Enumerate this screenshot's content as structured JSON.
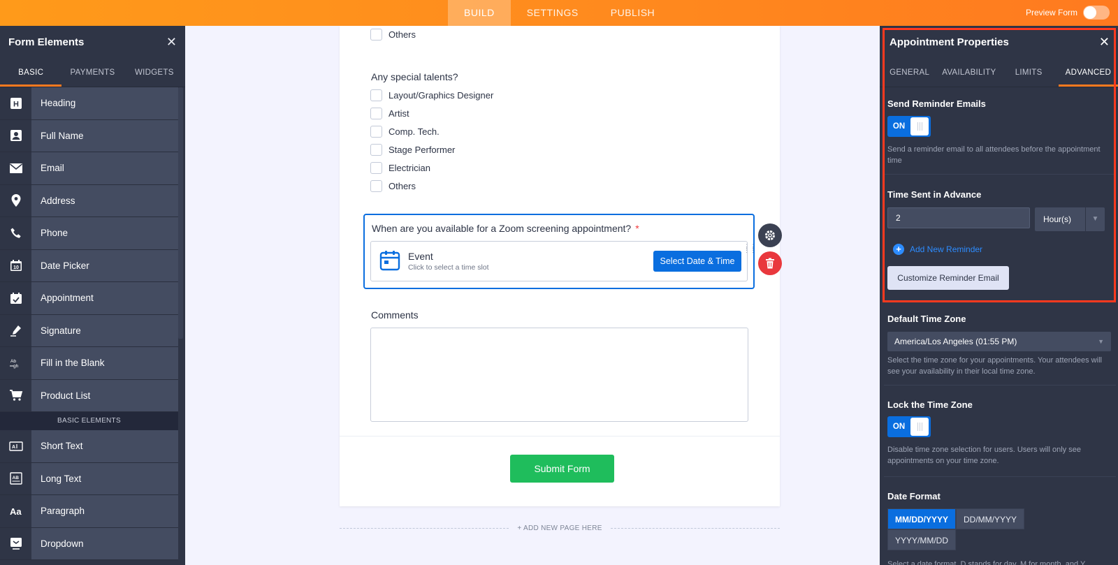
{
  "topbar": {
    "tabs": [
      "BUILD",
      "SETTINGS",
      "PUBLISH"
    ],
    "preview_label": "Preview Form"
  },
  "left_panel": {
    "title": "Form Elements",
    "tabs": [
      "BASIC",
      "PAYMENTS",
      "WIDGETS"
    ],
    "items": [
      {
        "label": "Heading",
        "icon": "heading-icon"
      },
      {
        "label": "Full Name",
        "icon": "person-icon"
      },
      {
        "label": "Email",
        "icon": "email-icon"
      },
      {
        "label": "Address",
        "icon": "location-pin-icon"
      },
      {
        "label": "Phone",
        "icon": "phone-icon"
      },
      {
        "label": "Date Picker",
        "icon": "calendar-icon"
      },
      {
        "label": "Appointment",
        "icon": "calendar-check-icon"
      },
      {
        "label": "Signature",
        "icon": "pen-icon"
      },
      {
        "label": "Fill in the Blank",
        "icon": "fill-blank-icon"
      },
      {
        "label": "Product List",
        "icon": "cart-icon"
      }
    ],
    "section_label": "BASIC ELEMENTS",
    "items2": [
      {
        "label": "Short Text",
        "icon": "short-text-icon"
      },
      {
        "label": "Long Text",
        "icon": "long-text-icon"
      },
      {
        "label": "Paragraph",
        "icon": "paragraph-icon"
      },
      {
        "label": "Dropdown",
        "icon": "dropdown-icon"
      }
    ]
  },
  "form": {
    "top_option": "Others",
    "talents_question": "Any special talents?",
    "talents_options": [
      "Layout/Graphics Designer",
      "Artist",
      "Comp. Tech.",
      "Stage Performer",
      "Electrician",
      "Others"
    ],
    "appointment_question": "When are you available for a Zoom screening appointment?",
    "required_mark": "*",
    "event_title": "Event",
    "event_subtitle": "Click to select a time slot",
    "select_button": "Select Date & Time",
    "comments_label": "Comments",
    "submit_label": "Submit Form",
    "add_page_label": "+ ADD NEW PAGE HERE"
  },
  "right_panel": {
    "title": "Appointment Properties",
    "tabs": [
      "GENERAL",
      "AVAILABILITY",
      "LIMITS",
      "ADVANCED"
    ],
    "send_reminder": {
      "title": "Send Reminder Emails",
      "toggle": "ON",
      "desc": "Send a reminder email to all attendees before the appointment time"
    },
    "time_advance": {
      "title": "Time Sent in Advance",
      "value": "2",
      "unit": "Hour(s)",
      "add_reminder": "Add New Reminder",
      "customize_button": "Customize Reminder Email"
    },
    "timezone": {
      "title": "Default Time Zone",
      "value": "America/Los Angeles (01:55 PM)",
      "desc": "Select the time zone for your appointments. Your attendees will see your availability in their local time zone."
    },
    "lock_tz": {
      "title": "Lock the Time Zone",
      "toggle": "ON",
      "desc": "Disable time zone selection for users. Users will only see appointments on your time zone."
    },
    "date_format": {
      "title": "Date Format",
      "options": [
        "MM/DD/YYYY",
        "DD/MM/YYYY",
        "YYYY/MM/DD"
      ],
      "desc": "Select a date format. D stands for day, M for month, and Y"
    }
  },
  "colors": {
    "accent_orange": "#ff7a1f",
    "primary_blue": "#0a6edf",
    "submit_green": "#1fbd5c",
    "panel_dark": "#2f3546",
    "highlight_red": "#ff3a1f"
  }
}
